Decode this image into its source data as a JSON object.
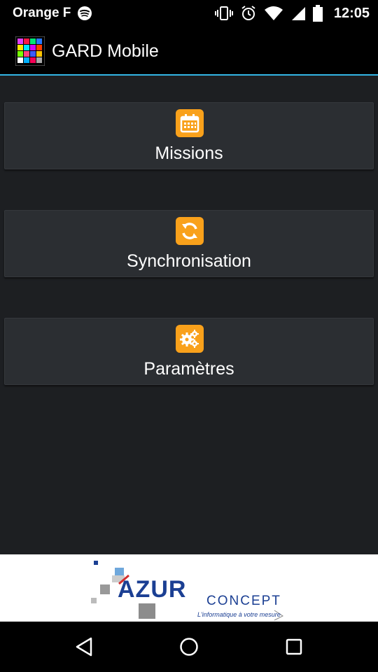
{
  "status_bar": {
    "carrier": "Orange F",
    "time": "12:05",
    "icons": [
      "spotify-icon",
      "vibrate-icon",
      "alarm-icon",
      "wifi-icon",
      "signal-icon",
      "battery-icon"
    ]
  },
  "app": {
    "title": "GARD Mobile",
    "accent_color": "#33b5e5"
  },
  "menu": {
    "items": [
      {
        "label": "Missions",
        "icon": "calendar-icon"
      },
      {
        "label": "Synchronisation",
        "icon": "sync-icon"
      },
      {
        "label": "Paramètres",
        "icon": "gears-icon"
      }
    ],
    "icon_color": "#f9a11b"
  },
  "ad": {
    "brand": "AZUR",
    "brand_suffix": "CONCEPT",
    "tagline": "L'informatique à votre mesure"
  },
  "nav": {
    "icons": [
      "back-icon",
      "home-icon",
      "recents-icon"
    ]
  }
}
